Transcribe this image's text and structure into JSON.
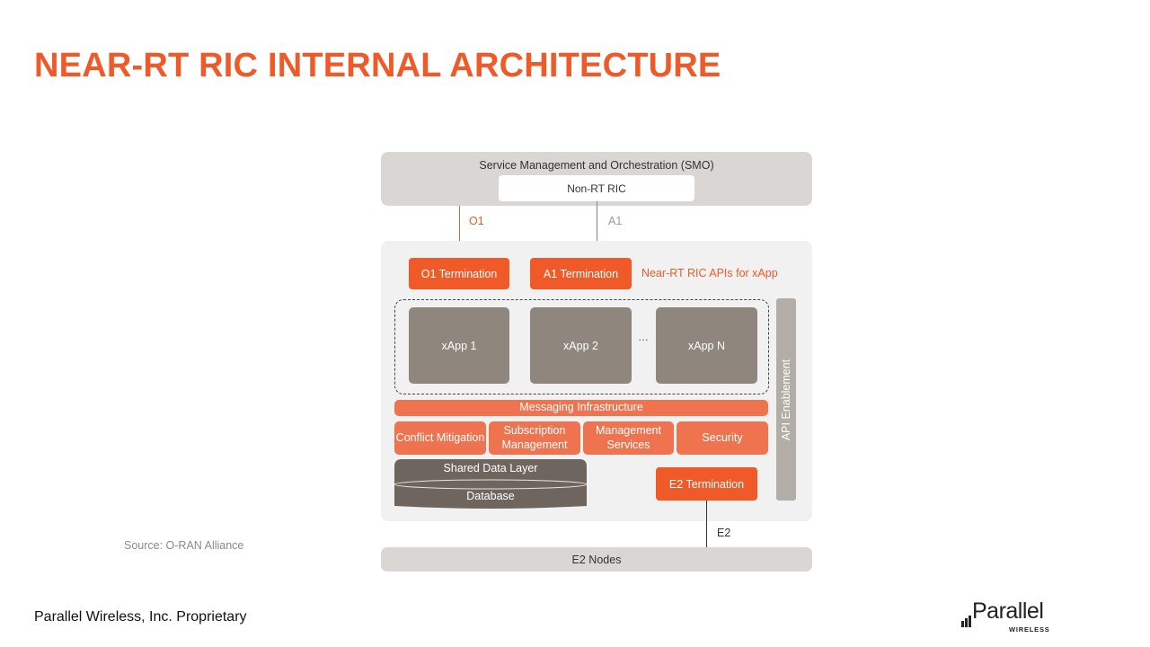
{
  "title": "NEAR-RT RIC INTERNAL ARCHITECTURE",
  "footer": "Parallel Wireless, Inc. Proprietary",
  "source": "Source: O-RAN  Alliance",
  "logo": {
    "word": "Parallel",
    "sub": "WIRELESS"
  },
  "colors": {
    "accent": "#f05a28",
    "module": "#f07350",
    "xapp": "#8f877e",
    "database": "#6e655e",
    "panel": "#f1f1f1",
    "smo": "#d9d6d3"
  },
  "diagram": {
    "smo_label": "Service Management  and  Orchestration (SMO)",
    "non_rt_ric": "Non-RT  RIC",
    "o1_link": "O1",
    "a1_link": "A1",
    "e2_link": "E2",
    "o1_termination": "O1 Termination",
    "a1_termination": "A1 Termination",
    "apis_label": "Near-RT RIC APIs for xApp",
    "xapps": [
      "xApp 1",
      "xApp 2",
      "xApp N"
    ],
    "ellipsis": "…",
    "messaging": "Messaging Infrastructure",
    "modules": [
      "Conflict Mitigation",
      "Subscription Management",
      "Management Services",
      "Security"
    ],
    "shared_data_layer": "Shared Data Layer",
    "database": "Database",
    "e2_termination": "E2 Termination",
    "api_enablement": "API Enablement",
    "e2_nodes": "E2 Nodes"
  }
}
